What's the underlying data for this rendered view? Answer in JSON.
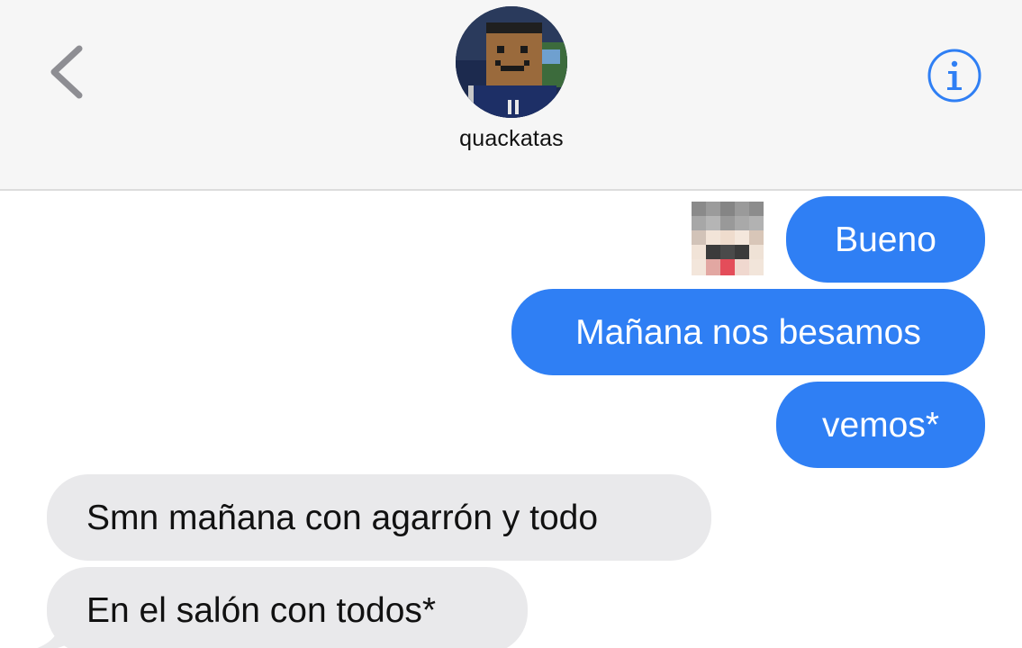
{
  "header": {
    "contact_name": "quackatas",
    "back_icon": "chevron-left-icon",
    "info_icon": "info-circle-icon",
    "accent_color": "#2f7ff4"
  },
  "messages": [
    {
      "direction": "outgoing",
      "text": "Bueno"
    },
    {
      "direction": "outgoing",
      "text": "Mañana nos besamos"
    },
    {
      "direction": "outgoing",
      "text": "vemos*"
    },
    {
      "direction": "incoming",
      "text": "Smn mañana con agarrón y todo"
    },
    {
      "direction": "incoming",
      "text": "En el salón con todos*"
    }
  ],
  "colors": {
    "outgoing_bubble": "#2f7ff4",
    "incoming_bubble": "#e9e9eb",
    "header_background": "#f6f6f6"
  }
}
